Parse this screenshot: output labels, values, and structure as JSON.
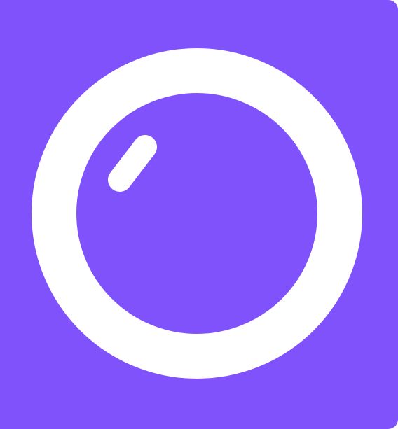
{
  "app_icon": {
    "icon": "lens-icon",
    "colors": {
      "background": "#8052fb",
      "ring": "#ffffff",
      "highlight": "#ffffff"
    }
  }
}
